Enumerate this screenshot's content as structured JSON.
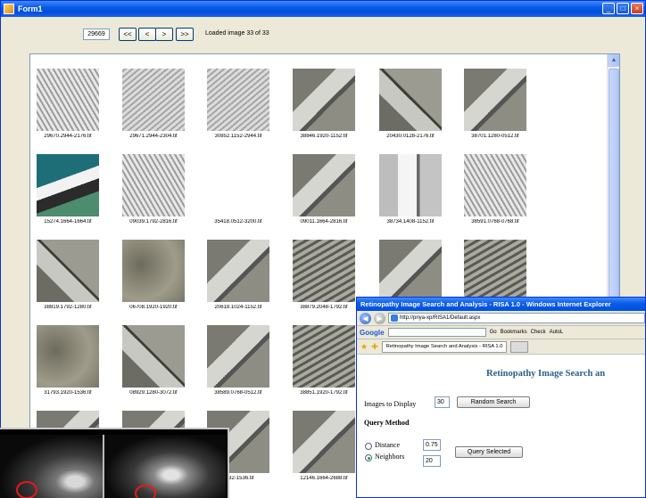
{
  "form1": {
    "title": "Form1",
    "image_id": "29669",
    "nav": {
      "first": "<<",
      "prev": "<",
      "next": ">",
      "last": ">>"
    },
    "status": "Loaded image 33 of 33"
  },
  "gallery": {
    "tiles": [
      "29670.2944-2176.tif",
      "29671.2944-2304.tif",
      "30852.1152-2944.tif",
      "38846.1920-1152.tif",
      "20430.0128-2176.tif",
      "38701.1280-0512.tif",
      "15274.1664-1664.tif",
      "09039.1792-2816.tif",
      "35418.0512-3200.tif",
      "09011.1664-2816.tif",
      "38734.1408-1152.tif",
      "38591.0768-0768.tif",
      "38819.1792-1280.tif",
      "06708.1920-1920.tif",
      "20618.1024-1152.tif",
      "38879.2048-1792.tif",
      "",
      "",
      "31793.1920-1536.tif",
      "08929.1280-3072.tif",
      "38589.0768-0512.tif",
      "38851.1920-1792.tif",
      "",
      "",
      "",
      "",
      "2432-1536.tif",
      "12146.1664-2688.tif",
      "",
      ""
    ]
  },
  "ie": {
    "title": "Retinopathy Image Search and Analysis - RISA 1.0 - Windows Internet Explorer",
    "url": "http://priya-xp/RISA1/Default.aspx",
    "google_label": "Google",
    "go_label": "Go",
    "bookmarks_label": "Bookmarks",
    "check_label": "Check",
    "autolink_label": "AutoL",
    "tab_label": "Retinopathy Image Search and Analysis - RISA 1.0",
    "heading": "Retinopathy Image Search an",
    "images_to_display_label": "Images to Display",
    "images_to_display_value": "30",
    "random_search_label": "Random Search",
    "query_method_label": "Query Method",
    "distance_label": "Distance",
    "distance_value": "0.75",
    "neighbors_label": "Neighbors",
    "neighbors_value": "20",
    "query_selected_label": "Query Selected"
  }
}
